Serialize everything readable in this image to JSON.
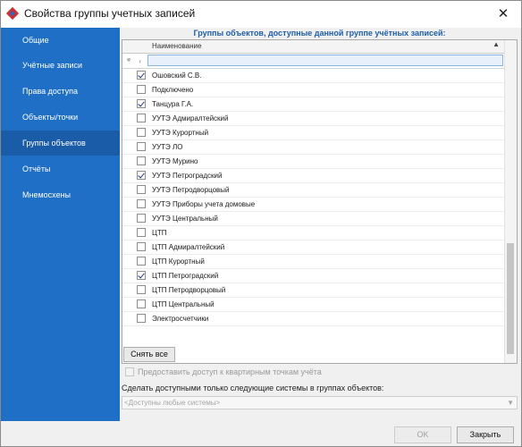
{
  "window": {
    "title": "Свойства группы учетных записей",
    "close_glyph": "✕"
  },
  "sidebar": {
    "items": [
      {
        "label": "Общие",
        "active": false
      },
      {
        "label": "Учётные записи",
        "active": false
      },
      {
        "label": "Права доступа",
        "active": false
      },
      {
        "label": "Объекты/точки",
        "active": false
      },
      {
        "label": "Группы объектов",
        "active": true
      },
      {
        "label": "Отчёты",
        "active": false
      },
      {
        "label": "Мнемосхены",
        "active": false
      }
    ]
  },
  "main": {
    "section_title": "Группы объектов, доступные данной группе учётных записей:",
    "grid": {
      "column_header": "Наименование",
      "sort_glyph": "▲",
      "filter_glyphs": {
        "pin": "ᵠ",
        "filter": "ᵣ"
      },
      "rows": [
        {
          "label": "Ошовский С.В.",
          "checked": true
        },
        {
          "label": "Подключено",
          "checked": false
        },
        {
          "label": "Танцура Г.А.",
          "checked": true
        },
        {
          "label": "УУТЭ Адмиралтейский",
          "checked": false
        },
        {
          "label": "УУТЭ Курортный",
          "checked": false
        },
        {
          "label": "УУТЭ ЛО",
          "checked": false
        },
        {
          "label": "УУТЭ Мурино",
          "checked": false
        },
        {
          "label": "УУТЭ Петроградский",
          "checked": true
        },
        {
          "label": "УУТЭ Петродворцовый",
          "checked": false
        },
        {
          "label": "УУТЭ Приборы учета домовые",
          "checked": false
        },
        {
          "label": "УУТЭ Центральный",
          "checked": false
        },
        {
          "label": "ЦТП",
          "checked": false
        },
        {
          "label": "ЦТП Адмиралтейский",
          "checked": false
        },
        {
          "label": "ЦТП Курортный",
          "checked": false
        },
        {
          "label": "ЦТП Петроградский",
          "checked": true
        },
        {
          "label": "ЦТП Петродворцовый",
          "checked": false
        },
        {
          "label": "ЦТП Центральный",
          "checked": false
        },
        {
          "label": "Электросчетчики",
          "checked": false
        }
      ]
    },
    "clear_all_label": "Снять все",
    "apartment_option_label": "Предоставить доступ к квартирным точкам учёта",
    "systems_label": "Сделать доступными только следующие системы в группах объектов:",
    "systems_select_value": "<Доступны любые системы>"
  },
  "footer": {
    "ok_label": "OK",
    "close_label": "Закрыть"
  }
}
